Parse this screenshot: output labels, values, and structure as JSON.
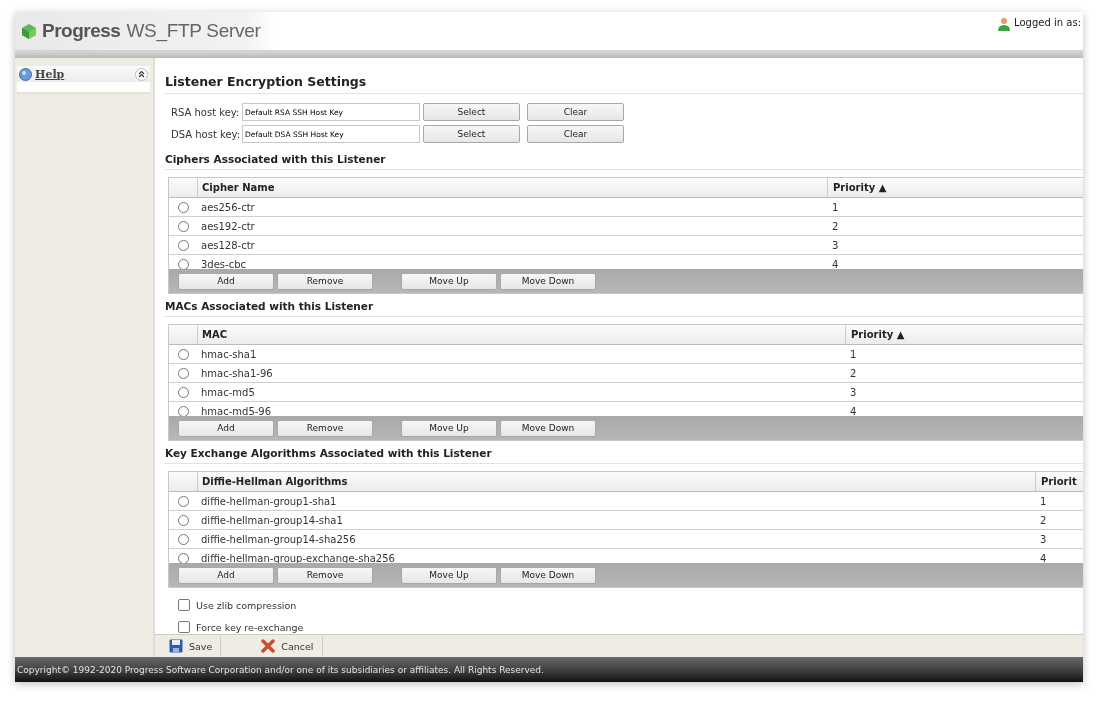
{
  "header": {
    "product": "Progress",
    "product_suffix": "WS_FTP Server",
    "user_label": "Logged in as:"
  },
  "sidebar": {
    "panel": {
      "title": "Help",
      "expanded": true
    }
  },
  "title": "Listener Encryption Settings",
  "host_keys": [
    {
      "label": "RSA host key:",
      "value": "Default RSA SSH Host Key",
      "buttons": [
        "Select",
        "Clear"
      ]
    },
    {
      "label": "DSA host key:",
      "value": "Default DSA SSH Host Key",
      "buttons": [
        "Select",
        "Clear"
      ]
    }
  ],
  "sections": [
    {
      "heading": "Ciphers Associated with this Listener",
      "columns": [
        "Cipher Name",
        "Priority ▲"
      ],
      "rows": [
        {
          "name": "aes256-ctr",
          "priority": "1",
          "selected": false
        },
        {
          "name": "aes192-ctr",
          "priority": "2",
          "selected": false
        },
        {
          "name": "aes128-ctr",
          "priority": "3",
          "selected": false
        },
        {
          "name": "3des-cbc",
          "priority": "4",
          "selected": false
        }
      ],
      "buttons": [
        "Add",
        "Remove",
        "Move Up",
        "Move Down"
      ]
    },
    {
      "heading": "MACs Associated with this Listener",
      "columns": [
        "MAC",
        "Priority ▲"
      ],
      "rows": [
        {
          "name": "hmac-sha1",
          "priority": "1",
          "selected": false
        },
        {
          "name": "hmac-sha1-96",
          "priority": "2",
          "selected": false
        },
        {
          "name": "hmac-md5",
          "priority": "3",
          "selected": false
        },
        {
          "name": "hmac-md5-96",
          "priority": "4",
          "selected": false
        }
      ],
      "buttons": [
        "Add",
        "Remove",
        "Move Up",
        "Move Down"
      ]
    },
    {
      "heading": "Key Exchange Algorithms Associated with this Listener",
      "columns": [
        "Diffie-Hellman Algorithms",
        "Priorit"
      ],
      "rows": [
        {
          "name": "diffie-hellman-group1-sha1",
          "priority": "1",
          "selected": false
        },
        {
          "name": "diffie-hellman-group14-sha1",
          "priority": "2",
          "selected": false
        },
        {
          "name": "diffie-hellman-group14-sha256",
          "priority": "3",
          "selected": false
        },
        {
          "name": "diffie-hellman-group-exchange-sha256",
          "priority": "4",
          "selected": false
        }
      ],
      "buttons": [
        "Add",
        "Remove",
        "Move Up",
        "Move Down"
      ]
    }
  ],
  "options": [
    {
      "label": "Use zlib compression",
      "checked": false
    },
    {
      "label": "Force key re-exchange",
      "checked": false
    }
  ],
  "toolbar": [
    {
      "kind": "save",
      "label": "Save"
    },
    {
      "kind": "cancel",
      "label": "Cancel"
    }
  ],
  "footer": "Copyright© 1992-2020 Progress Software Corporation and/or one of its subsidiaries or affiliates. All Rights Reserved."
}
